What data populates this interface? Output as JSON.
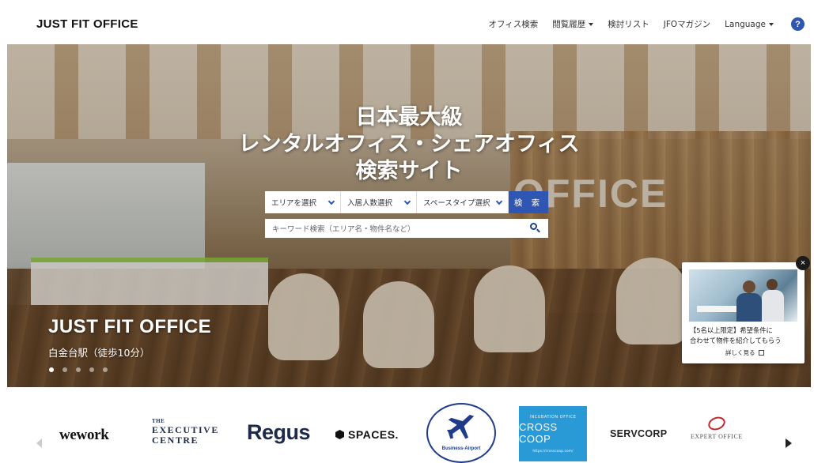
{
  "header": {
    "logo": "JUST FIT OFFICE",
    "nav": {
      "office_search": "オフィス検索",
      "history": "閲覧履歴",
      "consider_list": "検討リスト",
      "magazine": "JFOマガジン",
      "language": "Language"
    },
    "help_icon": "?"
  },
  "hero": {
    "title_lines": [
      "日本最大級",
      "レンタルオフィス・シェアオフィス",
      "検索サイト"
    ],
    "search": {
      "area_select": "エリアを選択",
      "people_select": "入居人数選択",
      "space_type_select": "スペースタイプ選択",
      "submit": "検 索",
      "keyword_placeholder": "キーワード検索（エリア名・物件名など）"
    },
    "background_sign": "OFFICE",
    "slide": {
      "title": "JUST FIT OFFICE",
      "subtitle": "白金台駅（徒歩10分）",
      "dots_total": 5,
      "active_dot": 1
    }
  },
  "popup": {
    "line1": "【5名以上限定】希望条件に",
    "line2": "合わせて物件を紹介してもらう",
    "link": "詳しく見る",
    "close": "×"
  },
  "brands": {
    "wework": "wework",
    "executive_centre": [
      "THE",
      "EXECUTIVE",
      "CENTRE"
    ],
    "regus": "Regus",
    "spaces": "SPACES.",
    "business_airport": "Business-Airport",
    "crosscoop": {
      "top": "INCUBATION OFFICE",
      "name": "CROSS COOP",
      "url": "https://crosscoop.com/"
    },
    "servcorp": "SERVCORP",
    "expert_office": "EXPERT OFFICE"
  },
  "colors": {
    "accent_blue": "#2f56b3",
    "brand_navy": "#1e2a4a",
    "crosscoop_blue": "#2a9ad6",
    "expert_red": "#c0272d"
  }
}
